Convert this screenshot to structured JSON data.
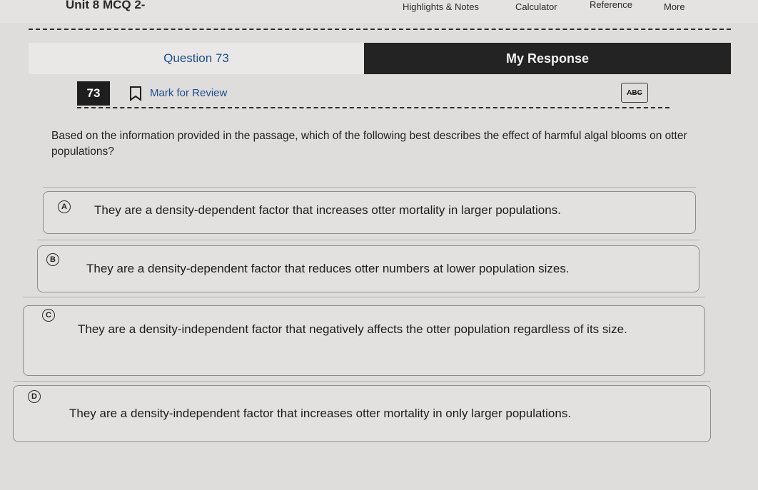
{
  "header": {
    "title": "Unit 8 MCQ 2-",
    "menu": [
      "Highlights & Notes",
      "Calculator",
      "Reference",
      "More"
    ]
  },
  "tabs": {
    "question": "Question 73",
    "response": "My Response"
  },
  "question_bar": {
    "number": "73",
    "mark_label": "Mark for Review",
    "abc_label": "ABC"
  },
  "question": {
    "text": "Based on the information provided in the passage, which of the following best describes the effect of harmful algal blooms on otter populations?"
  },
  "choices": [
    {
      "letter": "A",
      "text": "They are a density-dependent factor that increases otter mortality in larger populations."
    },
    {
      "letter": "B",
      "text": "They are a density-dependent factor that reduces otter numbers at lower population sizes."
    },
    {
      "letter": "C",
      "text": "They are a density-independent factor that negatively affects the otter population regardless of its size."
    },
    {
      "letter": "D",
      "text": "They are a density-independent factor that increases otter mortality in only larger populations."
    }
  ]
}
